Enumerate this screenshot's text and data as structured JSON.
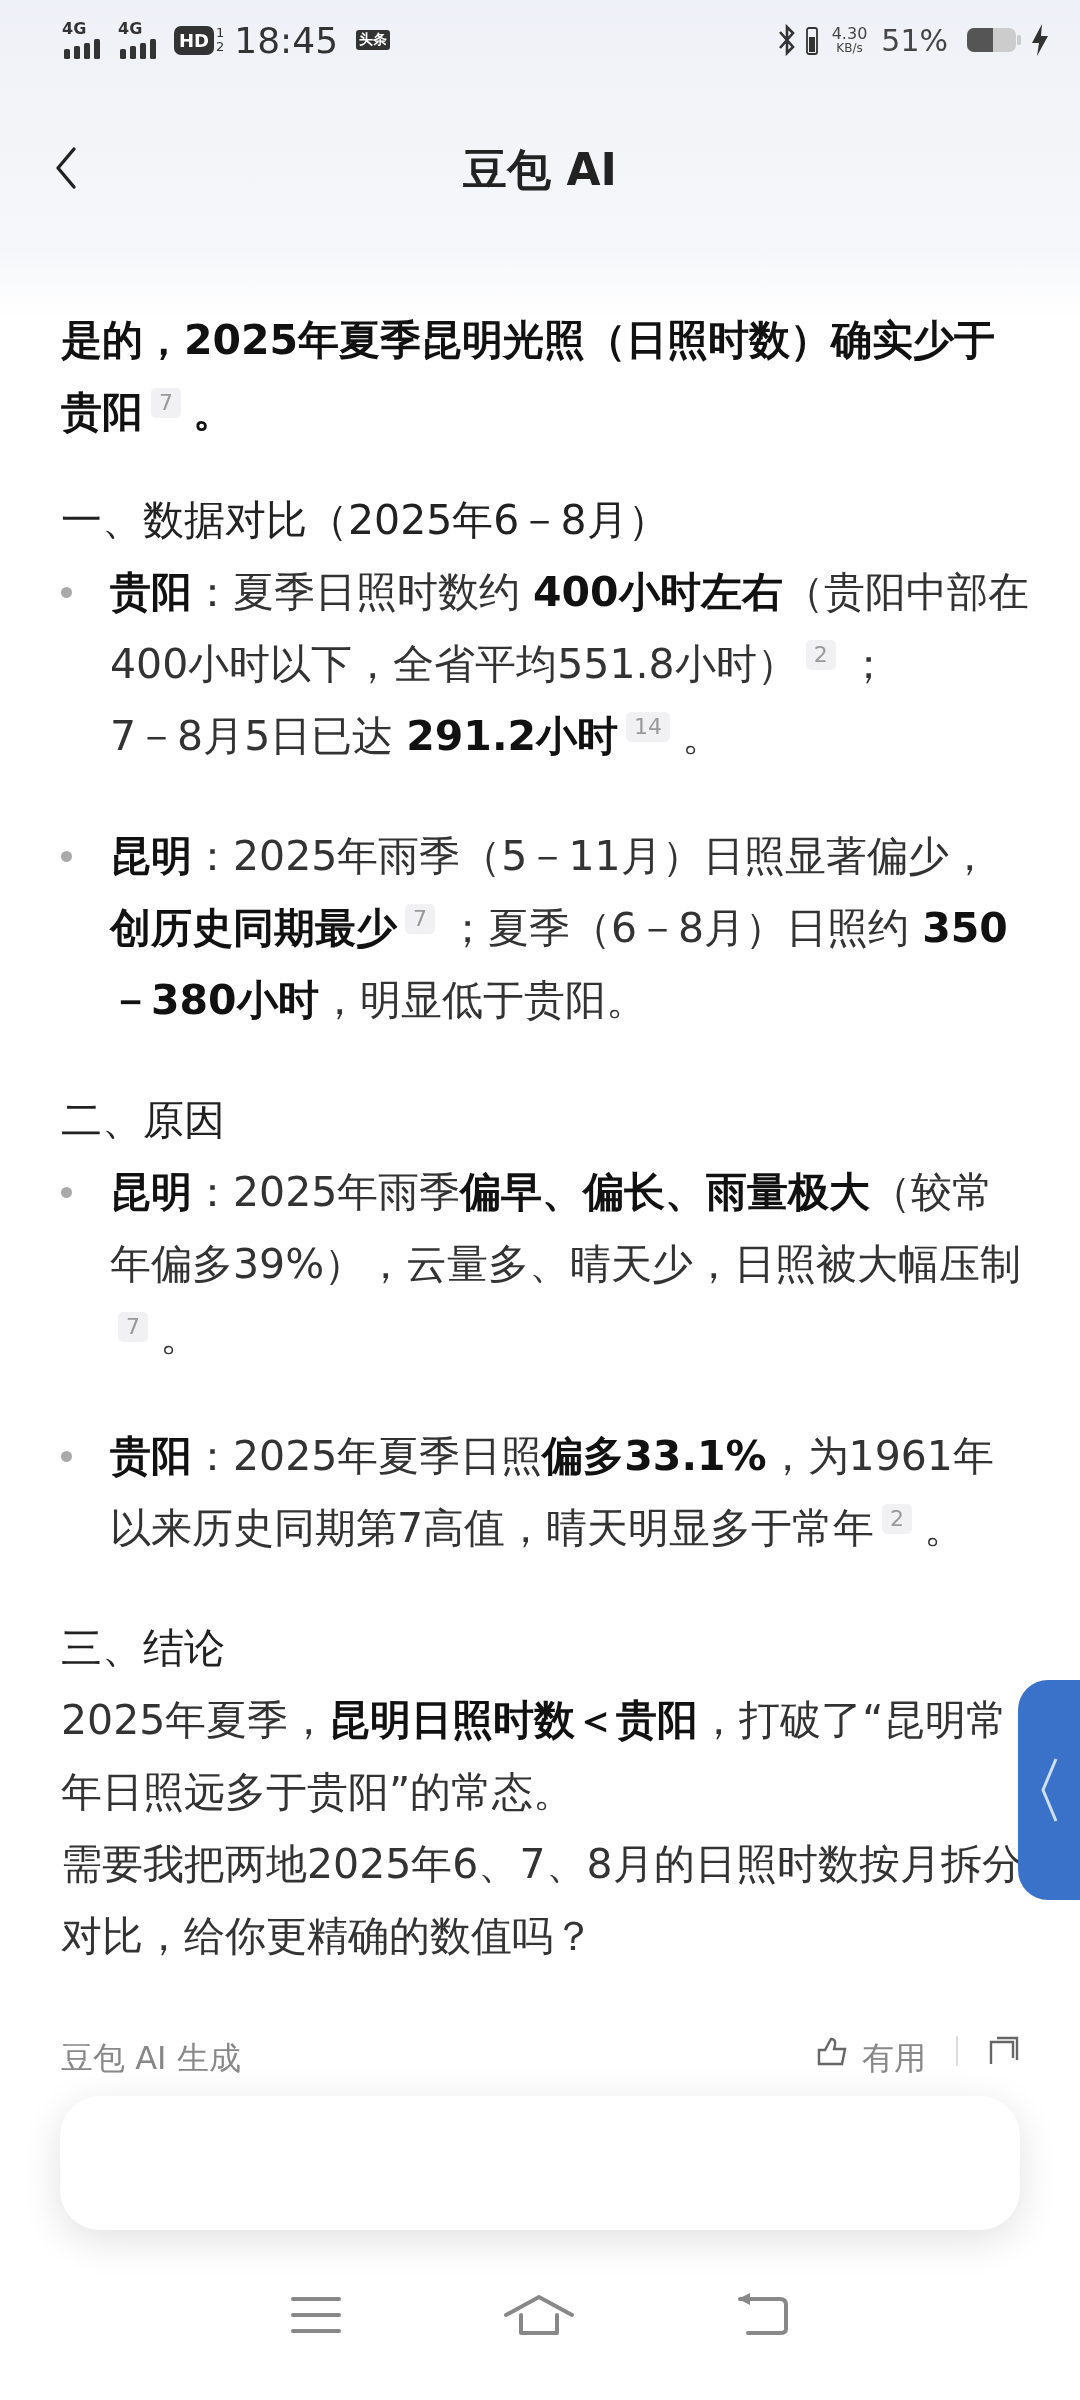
{
  "status_bar": {
    "networks": [
      "4G",
      "4G"
    ],
    "hd": "HD",
    "hd_sims": [
      "1",
      "2"
    ],
    "time": "18:45",
    "app_badge": "头条",
    "speed": "4.30",
    "speed_unit": "KB/s",
    "battery": "51%",
    "charging": true
  },
  "header": {
    "title": "豆包 AI"
  },
  "blocks": [
    {
      "kind": "lead",
      "parts": [
        {
          "kind": "text",
          "text": "是的，2025年夏季昆明光照（日照时数）确实少于贵阳"
        },
        {
          "kind": "cite",
          "text": "7"
        },
        {
          "kind": "text",
          "text": "。"
        }
      ]
    },
    {
      "kind": "heading",
      "parts": [
        {
          "kind": "text",
          "text": "一、数据对比（2025年6－8月）"
        }
      ]
    },
    {
      "kind": "bullet",
      "parts": [
        {
          "kind": "text",
          "text": "**贵阳**：夏季日照时数约 **400小时左右**（贵阳中部在400小时以下，全省平均551.8小时）"
        },
        {
          "kind": "cite",
          "text": "2"
        },
        {
          "kind": "text",
          "text": "；"
        },
        {
          "kind": "break"
        },
        {
          "kind": "text",
          "text": "7－8月5日已达 **291.2小时**"
        },
        {
          "kind": "cite",
          "text": "14"
        },
        {
          "kind": "text",
          "text": "。"
        }
      ]
    },
    {
      "kind": "bullet",
      "parts": [
        {
          "kind": "text",
          "text": "**昆明**：2025年雨季（5－11月）日照显著偏少，**创历史同期最少**"
        },
        {
          "kind": "cite",
          "text": "7"
        },
        {
          "kind": "text",
          "text": "；夏季（6－8月）日照约 **350－380小时**，明显低于贵阳。"
        }
      ]
    },
    {
      "kind": "heading",
      "parts": [
        {
          "kind": "text",
          "text": "二、原因"
        }
      ]
    },
    {
      "kind": "bullet",
      "parts": [
        {
          "kind": "text",
          "text": "**昆明**：2025年雨季**偏早、偏长、雨量极大**（较常年偏多39%），云量多、晴天少，日照被大幅压制"
        },
        {
          "kind": "cite",
          "text": "7"
        },
        {
          "kind": "text",
          "text": "。"
        }
      ]
    },
    {
      "kind": "bullet",
      "parts": [
        {
          "kind": "text",
          "text": "**贵阳**：2025年夏季日照**偏多33.1%**，为1961年以来历史同期第7高值，晴天明显多于常年"
        },
        {
          "kind": "cite",
          "text": "2"
        },
        {
          "kind": "text",
          "text": "。"
        }
      ]
    },
    {
      "kind": "heading",
      "parts": [
        {
          "kind": "text",
          "text": "三、结论"
        }
      ]
    },
    {
      "kind": "para",
      "parts": [
        {
          "kind": "text",
          "text": "2025年夏季，**昆明日照时数＜贵阳**，打破了“昆明常年日照远多于贵阳”的常态。"
        }
      ]
    },
    {
      "kind": "para",
      "parts": [
        {
          "kind": "text",
          "text": "需要我把两地2025年6、7、8月的日照时数按月拆分对比，给你更精确的数值吗？"
        }
      ]
    }
  ],
  "footer": {
    "source": "豆包 AI 生成",
    "useful": "有用"
  }
}
